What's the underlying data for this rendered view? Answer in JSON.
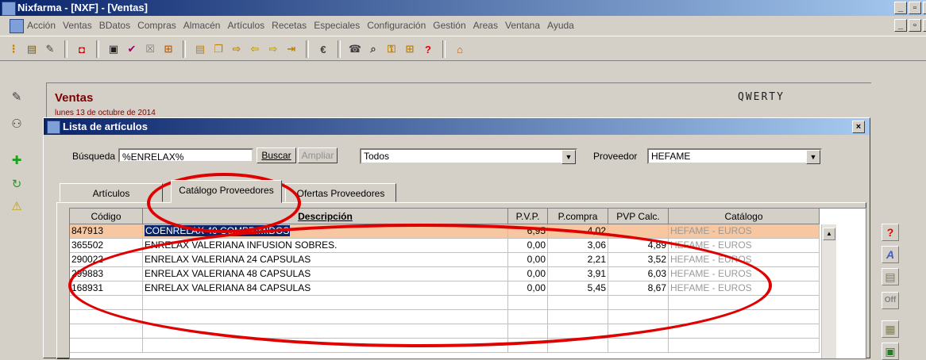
{
  "window": {
    "title": "Nixfarma - [NXF] - [Ventas]"
  },
  "menu": [
    "Acción",
    "Ventas",
    "BDatos",
    "Compras",
    "Almacén",
    "Artículos",
    "Recetas",
    "Especiales",
    "Configuración",
    "Gestión",
    "Areas",
    "Ventana",
    "Ayuda"
  ],
  "ventas": {
    "title": "Ventas",
    "date": "lunes 13 de octubre de 2014",
    "user": "QWERTY"
  },
  "dialog": {
    "title": "Lista de artículos",
    "search_label": "Búsqueda",
    "search_value": "%ENRELAX%",
    "buscar_label": "Buscar",
    "ampliar_label": "Ampliar",
    "filter_value": "Todos",
    "proveedor_label": "Proveedor",
    "proveedor_value": "HEFAME",
    "tabs": [
      "Artículos",
      "Catálogo Proveedores",
      "Ofertas Proveedores"
    ]
  },
  "grid": {
    "headers": [
      "Código",
      "Descripción",
      "P.V.P.",
      "P.compra",
      "PVP Calc.",
      "Catálogo"
    ],
    "rows": [
      {
        "codigo": "847913",
        "descripcion": "COENRELAX 40 COMPRIMIDOS",
        "pvp": "6,95",
        "pcompra": "4,02",
        "pvpcalc": "",
        "catalogo": "HEFAME - EUROS",
        "selected": true
      },
      {
        "codigo": "365502",
        "descripcion": "ENRELAX VALERIANA INFUSION  SOBRES.",
        "pvp": "0,00",
        "pcompra": "3,06",
        "pvpcalc": "4,89",
        "catalogo": "HEFAME - EUROS"
      },
      {
        "codigo": "290022",
        "descripcion": "ENRELAX VALERIANA 24 CAPSULAS",
        "pvp": "0,00",
        "pcompra": "2,21",
        "pvpcalc": "3,52",
        "catalogo": "HEFAME - EUROS"
      },
      {
        "codigo": "299883",
        "descripcion": "ENRELAX VALERIANA 48 CAPSULAS",
        "pvp": "0,00",
        "pcompra": "3,91",
        "pvpcalc": "6,03",
        "catalogo": "HEFAME - EUROS"
      },
      {
        "codigo": "168931",
        "descripcion": "ENRELAX VALERIANA 84 CAPSULAS",
        "pvp": "0,00",
        "pcompra": "5,45",
        "pvpcalc": "8,67",
        "catalogo": "HEFAME - EUROS"
      }
    ]
  },
  "icons": {
    "toolbar": [
      "list-icon",
      "document-icon",
      "edit-icon",
      "stop-icon",
      "print-icon",
      "check-icon",
      "cancel-icon",
      "filter-icon",
      "document-icon",
      "copy-icon",
      "forward-icon",
      "arrow-left-icon",
      "arrow-right-icon",
      "exit-icon",
      "euro-icon",
      "phone-icon",
      "search-icon",
      "key-icon",
      "grid-icon",
      "help-icon",
      "home-icon"
    ],
    "left": [
      "pencil-icon",
      "users-icon",
      "add-icon",
      "refresh-icon",
      "warning-icon"
    ],
    "right": [
      "help-icon",
      "font-icon",
      "document-icon",
      "off-icon",
      "table-icon",
      "excel-icon"
    ]
  },
  "colors": {
    "annotation": "#e00000",
    "selected_row": "#f6c7a0",
    "title_bar": "#0a246a",
    "ventas_title": "#800000"
  }
}
